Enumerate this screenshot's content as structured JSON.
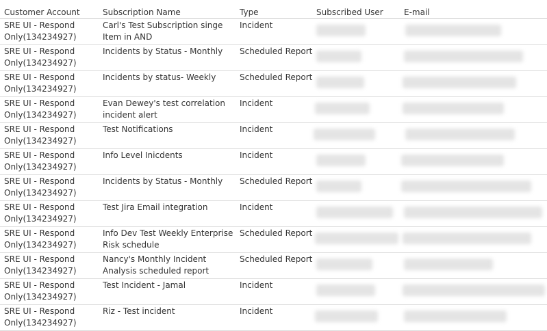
{
  "columns": {
    "account": "Customer Account",
    "name": "Subscription Name",
    "type": "Type",
    "user": "Subscribed User",
    "email": "E-mail"
  },
  "rows": [
    {
      "account": "SRE UI - Respond Only(134234927)",
      "name": "Carl's Test Subscription singe Item in AND",
      "type": "Incident"
    },
    {
      "account": "SRE UI - Respond Only(134234927)",
      "name": "Incidents by Status - Monthly",
      "type": "Scheduled Report"
    },
    {
      "account": "SRE UI - Respond Only(134234927)",
      "name": "Incidents by status- Weekly",
      "type": "Scheduled Report"
    },
    {
      "account": "SRE UI - Respond Only(134234927)",
      "name": "Evan Dewey's test correlation incident alert",
      "type": "Incident"
    },
    {
      "account": "SRE UI - Respond Only(134234927)",
      "name": "Test Notifications",
      "type": "Incident"
    },
    {
      "account": "SRE UI - Respond Only(134234927)",
      "name": "Info Level Inicdents",
      "type": "Incident"
    },
    {
      "account": "SRE UI - Respond Only(134234927)",
      "name": "Incidents by Status - Monthly",
      "type": "Scheduled Report"
    },
    {
      "account": "SRE UI - Respond Only(134234927)",
      "name": "Test Jira Email integration",
      "type": "Incident"
    },
    {
      "account": "SRE UI - Respond Only(134234927)",
      "name": "Info Dev Test Weekly Enterprise Risk schedule",
      "type": "Scheduled Report"
    },
    {
      "account": "SRE UI - Respond Only(134234927)",
      "name": "Nancy's Monthly Incident Analysis scheduled report",
      "type": "Scheduled Report"
    },
    {
      "account": "SRE UI - Respond Only(134234927)",
      "name": "Test Incident - Jamal",
      "type": "Incident"
    },
    {
      "account": "SRE UI - Respond Only(134234927)",
      "name": "Riz - Test incident",
      "type": "Incident"
    }
  ]
}
